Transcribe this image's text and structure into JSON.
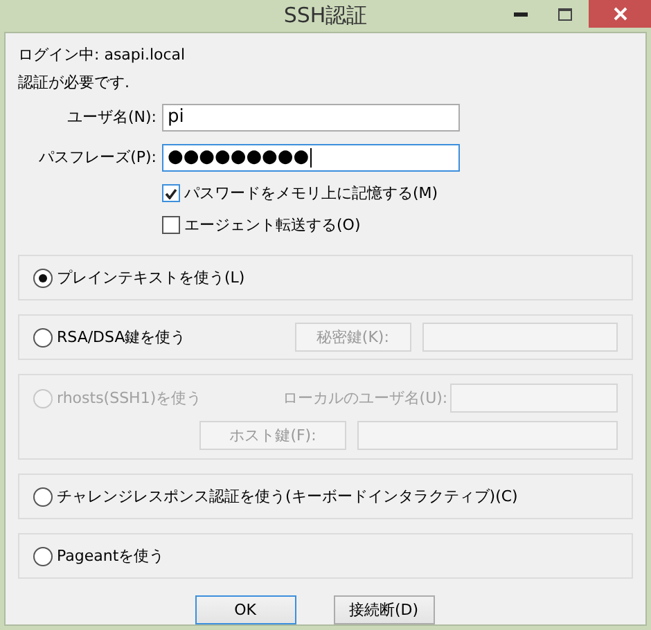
{
  "window": {
    "title": "SSH認証"
  },
  "login_line": "ログイン中: asapi.local",
  "message": "認証が必要です.",
  "fields": [
    {
      "label": "ユーザ名(N):",
      "value": "pi",
      "focused": false
    },
    {
      "label": "パスフレーズ(P):",
      "value": "●●●●●●●●●",
      "focused": true
    }
  ],
  "checkboxes": [
    {
      "label": "パスワードをメモリ上に記憶する(M)",
      "checked": true
    },
    {
      "label": "エージェント転送する(O)",
      "checked": false
    }
  ],
  "methods": [
    {
      "kind": "plain",
      "label": "プレインテキストを使う(L)",
      "selected": true,
      "disabled": false
    },
    {
      "kind": "key",
      "label": "RSA/DSA鍵を使う",
      "selected": false,
      "disabled": false,
      "button": "秘密鍵(K):"
    },
    {
      "kind": "rhosts",
      "label": "rhosts(SSH1)を使う",
      "selected": false,
      "disabled": true,
      "user_label": "ローカルのユーザ名(U):",
      "button": "ホスト鍵(F):"
    },
    {
      "kind": "plain",
      "label": "チャレンジレスポンス認証を使う(キーボードインタラクティブ)(C)",
      "selected": false,
      "disabled": false
    },
    {
      "kind": "plain",
      "label": "Pageantを使う",
      "selected": false,
      "disabled": false
    }
  ],
  "buttons": [
    {
      "label": "OK",
      "default": true
    },
    {
      "label": "接続断(D)",
      "default": false
    }
  ]
}
